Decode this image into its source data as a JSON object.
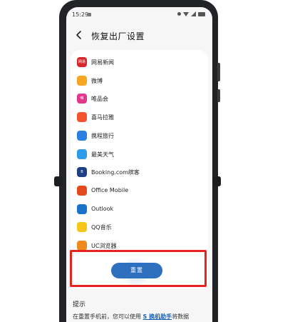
{
  "status_bar": {
    "time": "15:29"
  },
  "header": {
    "title": "恢复出厂设置"
  },
  "apps": [
    {
      "name": "网易新闻",
      "icon": "netease-news-icon",
      "color": "#d7262b",
      "badge": "网易"
    },
    {
      "name": "微博",
      "icon": "weibo-icon",
      "color": "#f6a623",
      "badge": ""
    },
    {
      "name": "唯品会",
      "icon": "vipshop-icon",
      "color": "#e2388c",
      "badge": "唯"
    },
    {
      "name": "喜马拉雅",
      "icon": "ximalaya-icon",
      "color": "#f0532d",
      "badge": ""
    },
    {
      "name": "携程旅行",
      "icon": "ctrip-icon",
      "color": "#2b7fe0",
      "badge": ""
    },
    {
      "name": "最美天气",
      "icon": "weather-icon",
      "color": "#2f9be8",
      "badge": ""
    },
    {
      "name": "Booking.com缤客",
      "icon": "booking-icon",
      "color": "#1e3f82",
      "badge": "B"
    },
    {
      "name": "Office Mobile",
      "icon": "office-icon",
      "color": "#e24a1d",
      "badge": ""
    },
    {
      "name": "Outlook",
      "icon": "outlook-icon",
      "color": "#1a73c9",
      "badge": ""
    },
    {
      "name": "QQ音乐",
      "icon": "qqmusic-icon",
      "color": "#f5c518",
      "badge": ""
    },
    {
      "name": "UC浏览器",
      "icon": "uc-browser-icon",
      "color": "#f08a1c",
      "badge": ""
    }
  ],
  "reset": {
    "label": "重置"
  },
  "tips": {
    "title": "提示",
    "text_before": "在重置手机前，您可以使用 ",
    "link": "S 换机助手",
    "text_after": "将数据"
  },
  "colors": {
    "accent": "#2f6fbf",
    "highlight": "#e3241f"
  }
}
